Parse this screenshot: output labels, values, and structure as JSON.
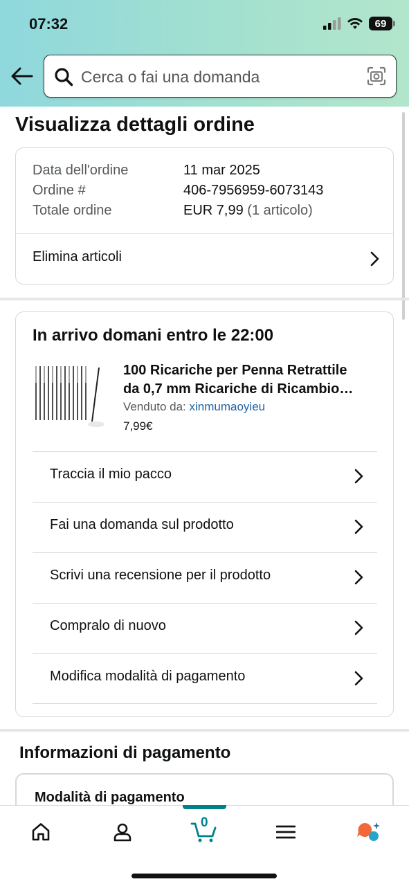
{
  "status_bar": {
    "time": "07:32",
    "battery": "69"
  },
  "search": {
    "placeholder": "Cerca o fai una domanda"
  },
  "page": {
    "title": "Visualizza dettagli ordine"
  },
  "order": {
    "date_label": "Data dell'ordine",
    "date_value": "11 mar 2025",
    "number_label": "Ordine #",
    "number_value": "406-7956959-6073143",
    "total_label": "Totale ordine",
    "total_value": "EUR 7,99",
    "total_items": "(1 articolo)",
    "delete_items_label": "Elimina articoli"
  },
  "delivery": {
    "title": "In arrivo domani entro le 22:00",
    "product": {
      "title_line1": "100 Ricariche per Penna Retrattile",
      "title_line2": "da 0,7 mm Ricariche di Ricambio…",
      "sold_by_label": "Venduto da:",
      "seller": "xinmumaoyieu",
      "price": "7,99€"
    },
    "actions": [
      {
        "label": "Traccia il mio pacco"
      },
      {
        "label": "Fai una domanda sul prodotto"
      },
      {
        "label": "Scrivi una recensione per il prodotto"
      },
      {
        "label": "Compralo di nuovo"
      },
      {
        "label": "Modifica modalità di pagamento"
      }
    ]
  },
  "payment": {
    "section_title": "Informazioni di pagamento",
    "method_label": "Modalità di pagamento"
  },
  "nav": {
    "items": [
      "home-icon",
      "account-icon",
      "cart-icon",
      "menu-icon",
      "rufus-icon"
    ],
    "cart_count": "0"
  },
  "colors": {
    "accent": "#00818a",
    "link": "#2162a1",
    "header_gradient_start": "#8fd8dd",
    "header_gradient_end": "#b2e6cc"
  }
}
